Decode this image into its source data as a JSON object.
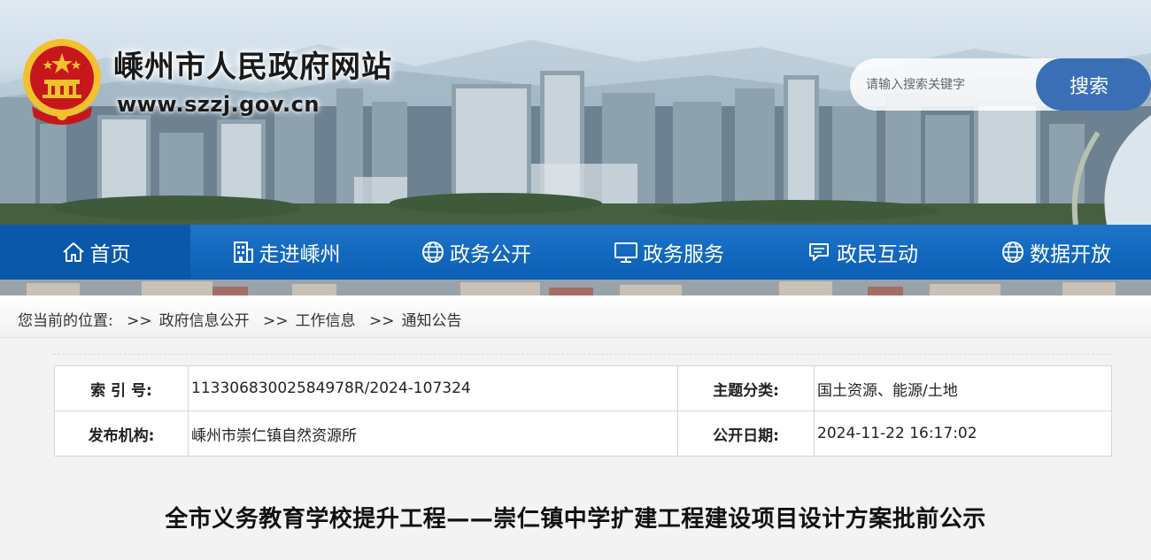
{
  "header": {
    "site_title": "嵊州市人民政府网站",
    "site_url": "www.szzj.gov.cn",
    "search_placeholder": "请输入搜索关键字",
    "search_button": "搜索"
  },
  "nav": {
    "items": [
      {
        "label": "首页",
        "icon": "home-icon"
      },
      {
        "label": "走进嵊州",
        "icon": "building-icon"
      },
      {
        "label": "政务公开",
        "icon": "globe-icon"
      },
      {
        "label": "政务服务",
        "icon": "monitor-icon"
      },
      {
        "label": "政民互动",
        "icon": "chat-icon"
      },
      {
        "label": "数据开放",
        "icon": "globe-icon"
      }
    ],
    "active_index": 0
  },
  "breadcrumb": {
    "prefix": "您当前的位置:",
    "items": [
      "政府信息公开",
      "工作信息",
      "通知公告"
    ],
    "separator": ">>"
  },
  "meta": {
    "index_label": "索 引 号:",
    "index_value": "11330683002584978R/2024-107324",
    "topic_label": "主题分类:",
    "topic_value": "国土资源、能源/土地",
    "publisher_label": "发布机构:",
    "publisher_value": "嵊州市崇仁镇自然资源所",
    "date_label": "公开日期:",
    "date_value": "2024-11-22 16:17:02"
  },
  "article": {
    "title": "全市义务教育学校提升工程——崇仁镇中学扩建工程建设项目设计方案批前公示"
  },
  "colors": {
    "nav_bg": "#0b5fb4",
    "nav_active": "#0a58aa",
    "search_button": "#3a6fb5",
    "emblem_red": "#c8161d",
    "emblem_gold": "#f2c12e"
  }
}
